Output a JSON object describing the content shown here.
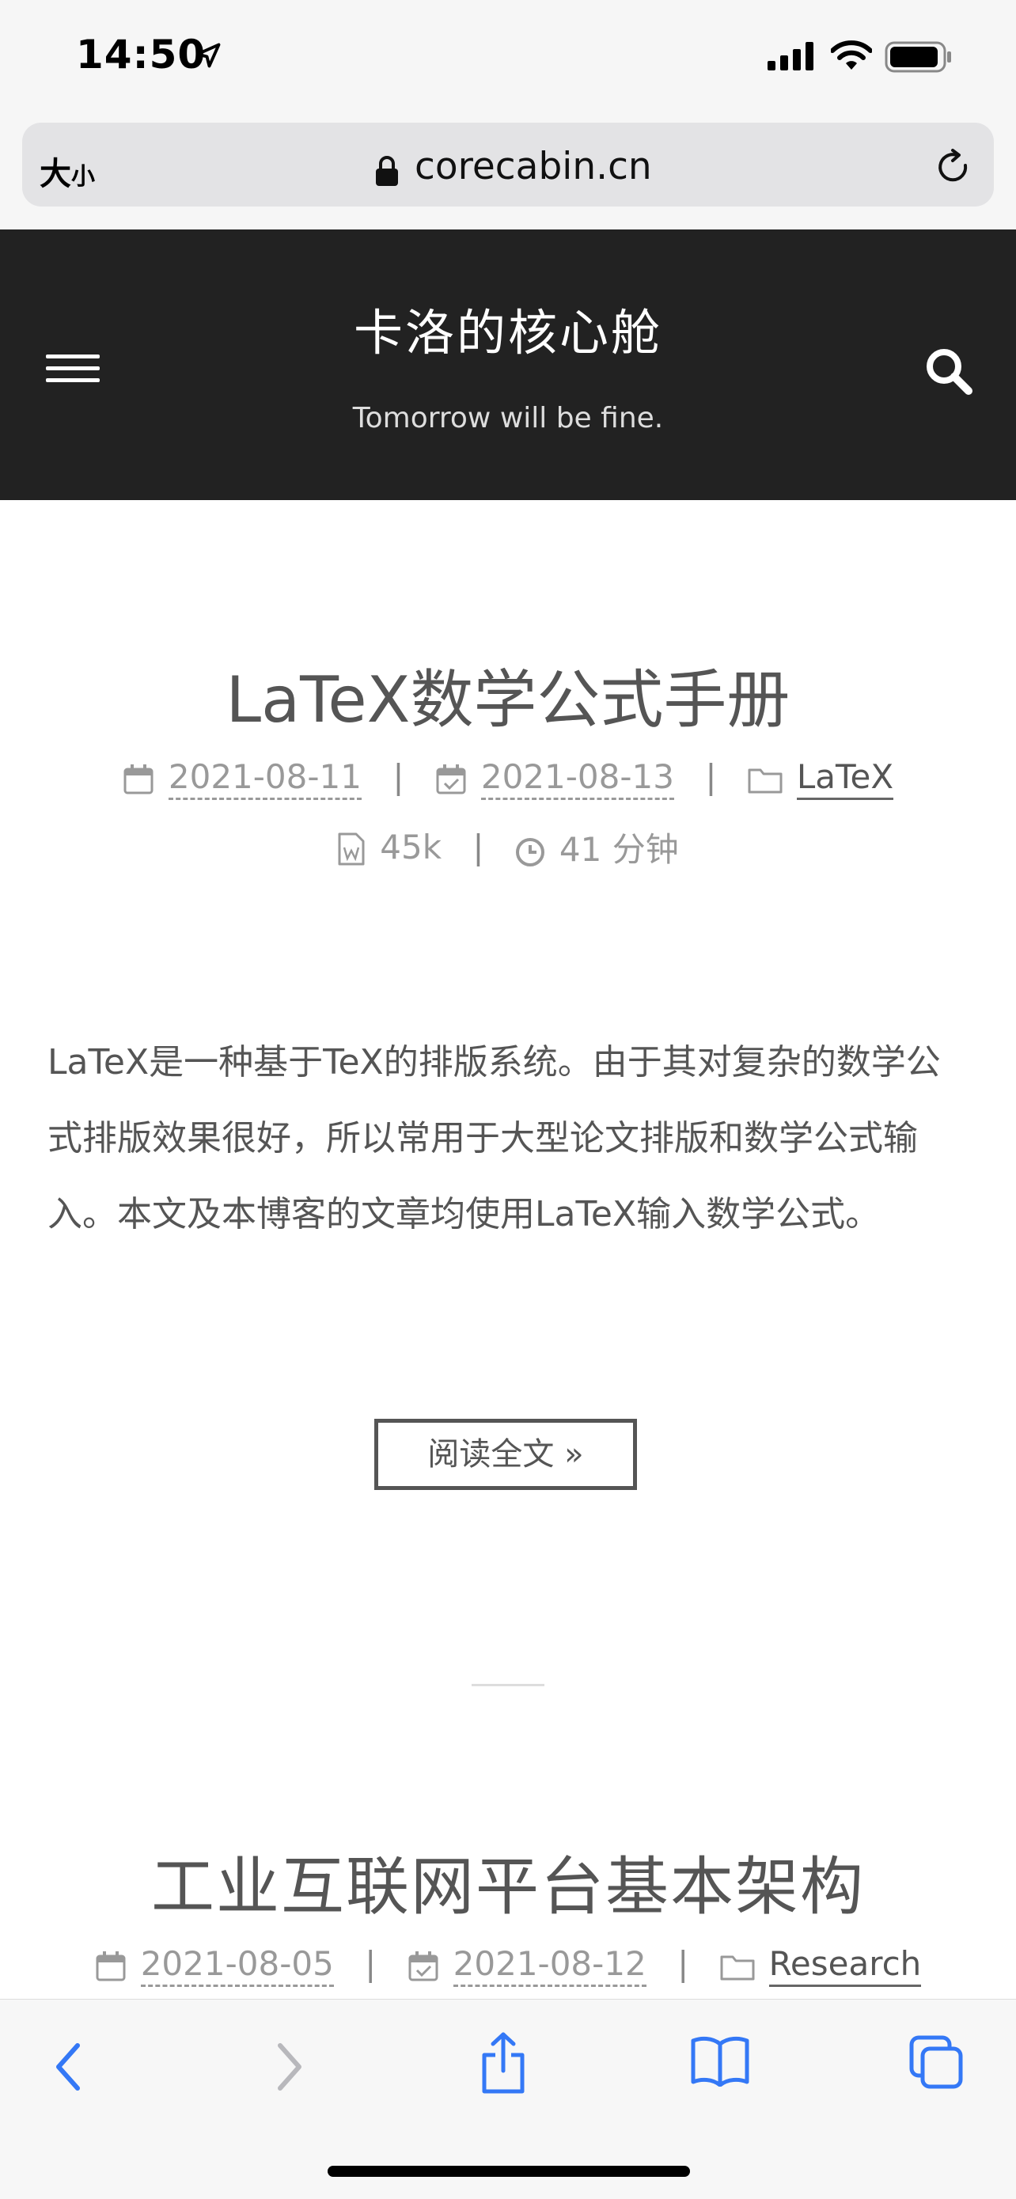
{
  "status_bar": {
    "time": "14:50"
  },
  "address_bar": {
    "text_size_big": "大",
    "text_size_small": "小",
    "url": "corecabin.cn"
  },
  "site": {
    "title": "卡洛的核心舱",
    "subtitle": "Tomorrow will be fine."
  },
  "posts": [
    {
      "title": "LaTeX数学公式手册",
      "created": "2021-08-11",
      "updated": "2021-08-13",
      "category": "LaTeX",
      "word_count": "45k",
      "read_time": "41 分钟",
      "excerpt": "LaTeX是一种基于TeX的排版系统。由于其对复杂的数学公式排版效果很好，所以常用于大型论文排版和数学公式输入。本文及本博客的文章均使用LaTeX输入数学公式。",
      "read_more": "阅读全文 »"
    },
    {
      "title": "工业互联网平台基本架构",
      "created": "2021-08-05",
      "updated": "2021-08-12",
      "category": "Research"
    }
  ],
  "meta_separator": "|",
  "icons": {
    "status": [
      "location-arrow-icon",
      "cellular-signal-icon",
      "wifi-icon",
      "battery-icon"
    ],
    "address": [
      "lock-icon",
      "reload-icon"
    ],
    "header": [
      "menu-icon",
      "search-icon"
    ],
    "meta": [
      "calendar-icon",
      "calendar-check-icon",
      "folder-icon",
      "word-file-icon",
      "clock-icon"
    ],
    "toolbar": [
      "back-icon",
      "forward-icon",
      "share-icon",
      "bookmarks-icon",
      "tabs-icon"
    ]
  },
  "colors": {
    "header_bg": "#222222",
    "toolbar_accent": "#3478f6",
    "text": "#555555"
  }
}
